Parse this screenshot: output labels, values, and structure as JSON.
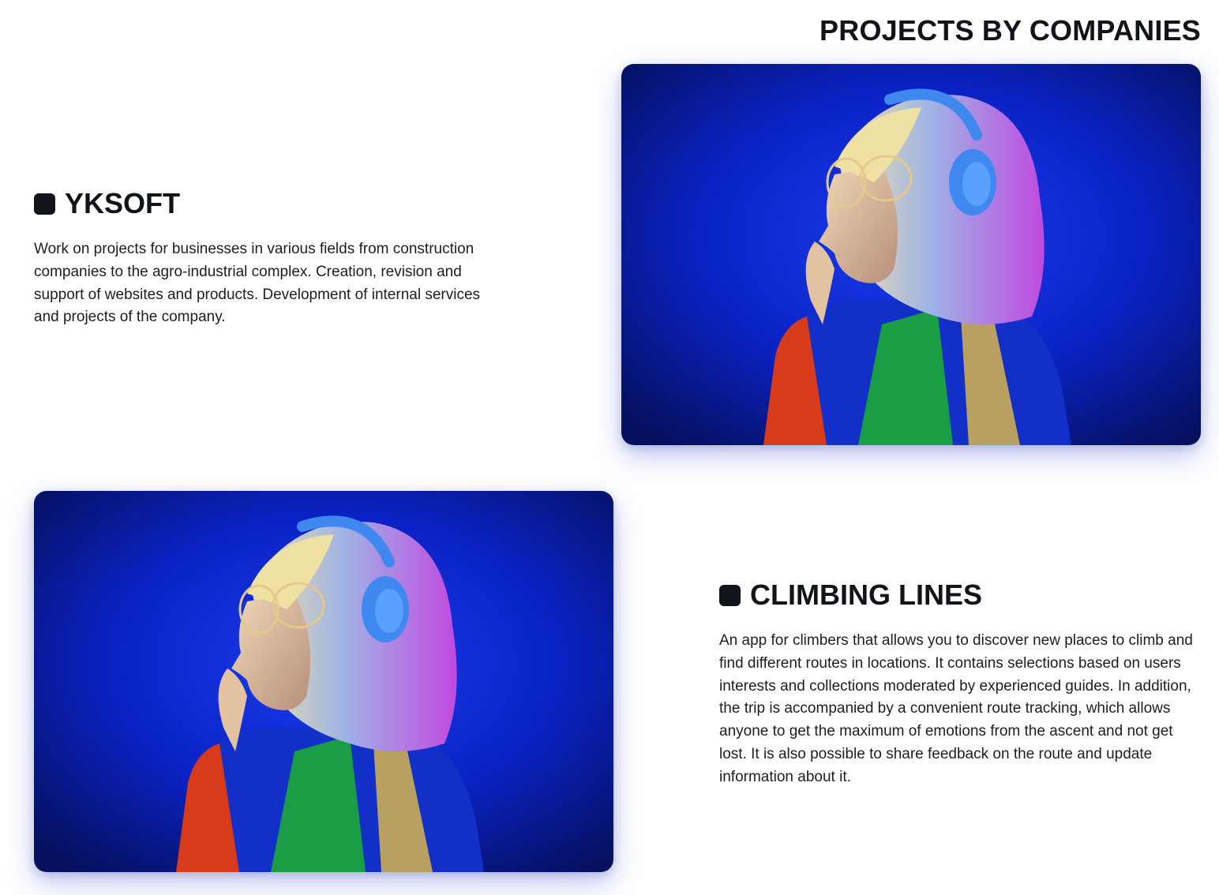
{
  "section": {
    "title": "PROJECTS BY COMPANIES"
  },
  "projects": [
    {
      "icon": "square-bullet-icon",
      "title": "YKSOFT",
      "description": "Work on projects for businesses in various fields from construction companies to the agro-industrial complex. Creation, revision and support of websites and products. Development of internal services and projects of the company."
    },
    {
      "icon": "square-bullet-icon",
      "title": "CLIMBING LINES",
      "description": "An app for climbers that allows you to discover new places to climb and find different routes in locations. It contains selections based on users interests and collections moderated by experienced guides. In addition, the trip is accompanied by a convenient route tracking, which allows anyone to get the maximum of emotions from the ascent and not get lost. It is also possible to share feedback on the route and update information about it."
    }
  ],
  "colors": {
    "text": "#111418",
    "image_background": "#0a1fc8",
    "headphones": "#3f88f0",
    "hair": "#e4d7a0",
    "jacket_red": "#d73b1c",
    "jacket_green": "#1a9d45"
  }
}
